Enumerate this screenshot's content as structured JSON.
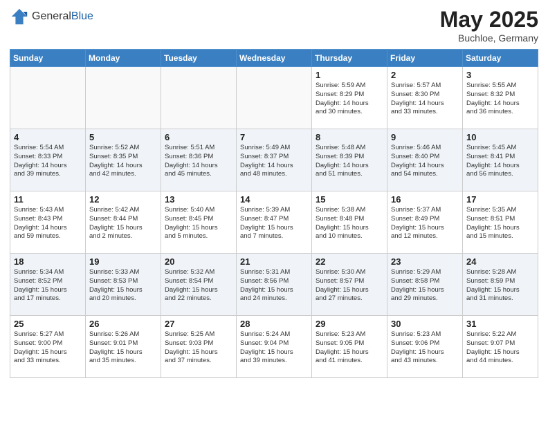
{
  "header": {
    "logo_general": "General",
    "logo_blue": "Blue",
    "month_year": "May 2025",
    "location": "Buchloe, Germany"
  },
  "day_headers": [
    "Sunday",
    "Monday",
    "Tuesday",
    "Wednesday",
    "Thursday",
    "Friday",
    "Saturday"
  ],
  "weeks": [
    [
      {
        "day": "",
        "info": ""
      },
      {
        "day": "",
        "info": ""
      },
      {
        "day": "",
        "info": ""
      },
      {
        "day": "",
        "info": ""
      },
      {
        "day": "1",
        "info": "Sunrise: 5:59 AM\nSunset: 8:29 PM\nDaylight: 14 hours\nand 30 minutes."
      },
      {
        "day": "2",
        "info": "Sunrise: 5:57 AM\nSunset: 8:30 PM\nDaylight: 14 hours\nand 33 minutes."
      },
      {
        "day": "3",
        "info": "Sunrise: 5:55 AM\nSunset: 8:32 PM\nDaylight: 14 hours\nand 36 minutes."
      }
    ],
    [
      {
        "day": "4",
        "info": "Sunrise: 5:54 AM\nSunset: 8:33 PM\nDaylight: 14 hours\nand 39 minutes."
      },
      {
        "day": "5",
        "info": "Sunrise: 5:52 AM\nSunset: 8:35 PM\nDaylight: 14 hours\nand 42 minutes."
      },
      {
        "day": "6",
        "info": "Sunrise: 5:51 AM\nSunset: 8:36 PM\nDaylight: 14 hours\nand 45 minutes."
      },
      {
        "day": "7",
        "info": "Sunrise: 5:49 AM\nSunset: 8:37 PM\nDaylight: 14 hours\nand 48 minutes."
      },
      {
        "day": "8",
        "info": "Sunrise: 5:48 AM\nSunset: 8:39 PM\nDaylight: 14 hours\nand 51 minutes."
      },
      {
        "day": "9",
        "info": "Sunrise: 5:46 AM\nSunset: 8:40 PM\nDaylight: 14 hours\nand 54 minutes."
      },
      {
        "day": "10",
        "info": "Sunrise: 5:45 AM\nSunset: 8:41 PM\nDaylight: 14 hours\nand 56 minutes."
      }
    ],
    [
      {
        "day": "11",
        "info": "Sunrise: 5:43 AM\nSunset: 8:43 PM\nDaylight: 14 hours\nand 59 minutes."
      },
      {
        "day": "12",
        "info": "Sunrise: 5:42 AM\nSunset: 8:44 PM\nDaylight: 15 hours\nand 2 minutes."
      },
      {
        "day": "13",
        "info": "Sunrise: 5:40 AM\nSunset: 8:45 PM\nDaylight: 15 hours\nand 5 minutes."
      },
      {
        "day": "14",
        "info": "Sunrise: 5:39 AM\nSunset: 8:47 PM\nDaylight: 15 hours\nand 7 minutes."
      },
      {
        "day": "15",
        "info": "Sunrise: 5:38 AM\nSunset: 8:48 PM\nDaylight: 15 hours\nand 10 minutes."
      },
      {
        "day": "16",
        "info": "Sunrise: 5:37 AM\nSunset: 8:49 PM\nDaylight: 15 hours\nand 12 minutes."
      },
      {
        "day": "17",
        "info": "Sunrise: 5:35 AM\nSunset: 8:51 PM\nDaylight: 15 hours\nand 15 minutes."
      }
    ],
    [
      {
        "day": "18",
        "info": "Sunrise: 5:34 AM\nSunset: 8:52 PM\nDaylight: 15 hours\nand 17 minutes."
      },
      {
        "day": "19",
        "info": "Sunrise: 5:33 AM\nSunset: 8:53 PM\nDaylight: 15 hours\nand 20 minutes."
      },
      {
        "day": "20",
        "info": "Sunrise: 5:32 AM\nSunset: 8:54 PM\nDaylight: 15 hours\nand 22 minutes."
      },
      {
        "day": "21",
        "info": "Sunrise: 5:31 AM\nSunset: 8:56 PM\nDaylight: 15 hours\nand 24 minutes."
      },
      {
        "day": "22",
        "info": "Sunrise: 5:30 AM\nSunset: 8:57 PM\nDaylight: 15 hours\nand 27 minutes."
      },
      {
        "day": "23",
        "info": "Sunrise: 5:29 AM\nSunset: 8:58 PM\nDaylight: 15 hours\nand 29 minutes."
      },
      {
        "day": "24",
        "info": "Sunrise: 5:28 AM\nSunset: 8:59 PM\nDaylight: 15 hours\nand 31 minutes."
      }
    ],
    [
      {
        "day": "25",
        "info": "Sunrise: 5:27 AM\nSunset: 9:00 PM\nDaylight: 15 hours\nand 33 minutes."
      },
      {
        "day": "26",
        "info": "Sunrise: 5:26 AM\nSunset: 9:01 PM\nDaylight: 15 hours\nand 35 minutes."
      },
      {
        "day": "27",
        "info": "Sunrise: 5:25 AM\nSunset: 9:03 PM\nDaylight: 15 hours\nand 37 minutes."
      },
      {
        "day": "28",
        "info": "Sunrise: 5:24 AM\nSunset: 9:04 PM\nDaylight: 15 hours\nand 39 minutes."
      },
      {
        "day": "29",
        "info": "Sunrise: 5:23 AM\nSunset: 9:05 PM\nDaylight: 15 hours\nand 41 minutes."
      },
      {
        "day": "30",
        "info": "Sunrise: 5:23 AM\nSunset: 9:06 PM\nDaylight: 15 hours\nand 43 minutes."
      },
      {
        "day": "31",
        "info": "Sunrise: 5:22 AM\nSunset: 9:07 PM\nDaylight: 15 hours\nand 44 minutes."
      }
    ]
  ]
}
